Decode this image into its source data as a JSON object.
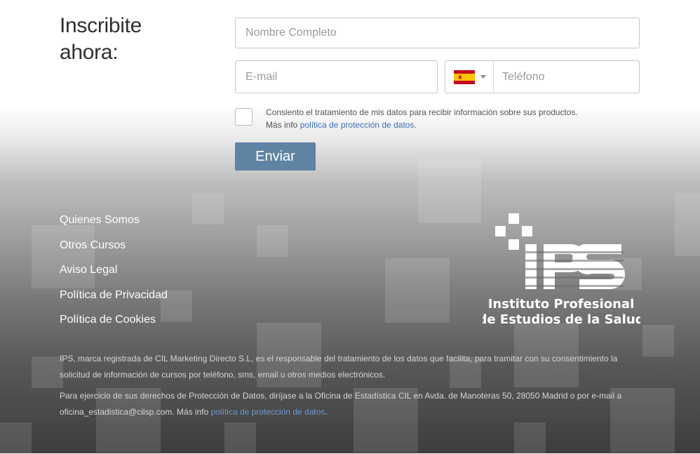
{
  "form": {
    "title": "Inscribite ahora:",
    "name_placeholder": "Nombre Completo",
    "email_placeholder": "E-mail",
    "phone_placeholder": "Teléfono",
    "phone_country": "es",
    "consent_text": "Consiento el tratamiento de mis datos para recibir información sobre sus productos.",
    "consent_more_prefix": "Más info",
    "consent_link": "política de protección de datos",
    "consent_suffix": ".",
    "submit_label": "Enviar"
  },
  "footer": {
    "nav": [
      "Quienes Somos",
      "Otros Cursos",
      "Aviso Legal",
      "Política de Privacidad",
      "Política de Cookies"
    ],
    "logo_line1": "Instituto Profesional",
    "logo_line2": "de Estudios de la Salud",
    "logo_mark": "IPS",
    "legal_1": "IPS, marca registrada de CIL Marketing Directo S.L, es el responsable del tratamiento de los datos que facilita, para tramitar con su consentimiento la solicitud de información de cursos por teléfono, sms, email u otros medios electrónicos.",
    "legal_2": "Para ejercicio de sus derechos de Protección de Datos, diríjase a la Oficina de Estadística CIL en Avda. de Manoteras 50, 28050 Madrid o por e-mail a oficina_estadistica@cilsp.com. Más info",
    "legal_2_link": "política de protección de datos",
    "legal_2_suffix": "."
  },
  "colors": {
    "button": "#5f83a3",
    "link": "#3d6fb6"
  }
}
